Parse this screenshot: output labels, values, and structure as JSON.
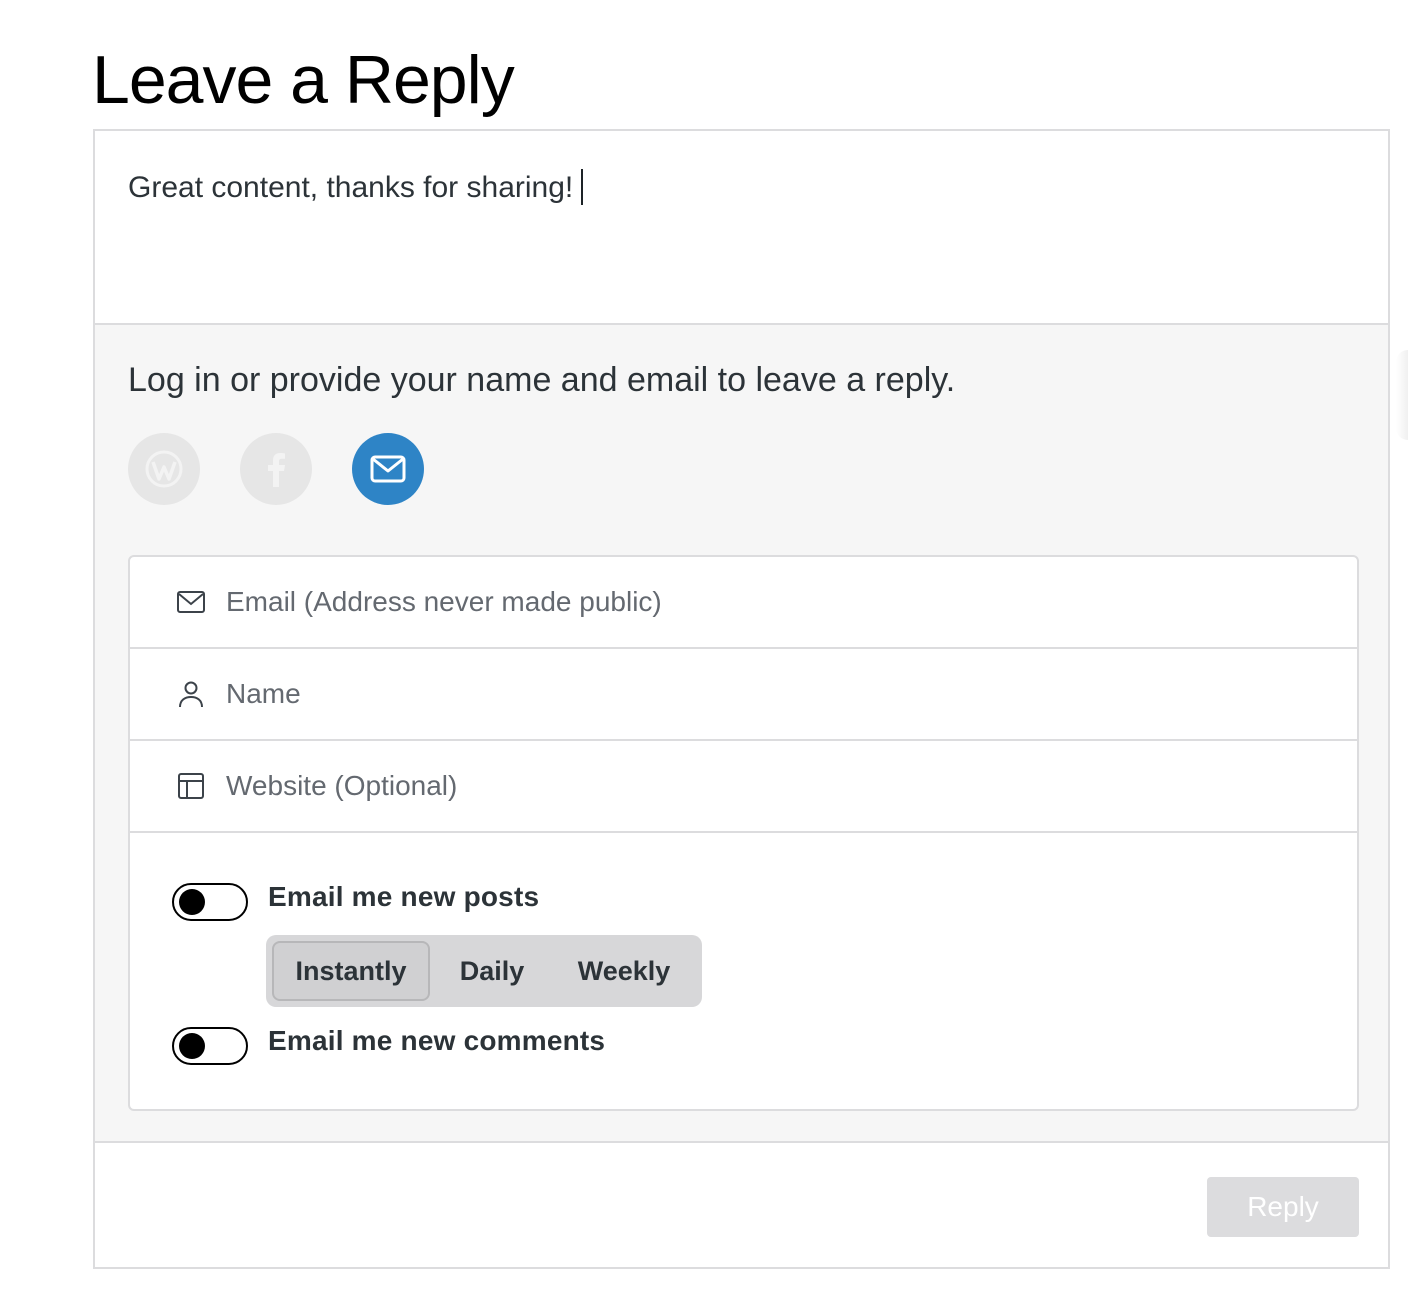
{
  "title": "Leave a Reply",
  "comment": {
    "text": "Great content, thanks for sharing!"
  },
  "login": {
    "prompt": "Log in or provide your name and email to leave a reply.",
    "services": [
      {
        "name": "wordpress",
        "icon": "wordpress-icon"
      },
      {
        "name": "facebook",
        "icon": "facebook-icon"
      },
      {
        "name": "email",
        "icon": "envelope-icon",
        "active": true
      }
    ]
  },
  "fields": {
    "email_placeholder": "Email (Address never made public)",
    "name_placeholder": "Name",
    "website_placeholder": "Website (Optional)"
  },
  "subscriptions": {
    "posts_label": "Email me new posts",
    "posts_enabled": false,
    "frequency_options": [
      "Instantly",
      "Daily",
      "Weekly"
    ],
    "frequency_selected": "Instantly",
    "comments_label": "Email me new comments",
    "comments_enabled": false
  },
  "reply_button": "Reply",
  "colors": {
    "accent": "#2e84c6",
    "panel": "#f6f6f6",
    "border": "#dcdcde",
    "disabled_button": "#dcdcde"
  }
}
